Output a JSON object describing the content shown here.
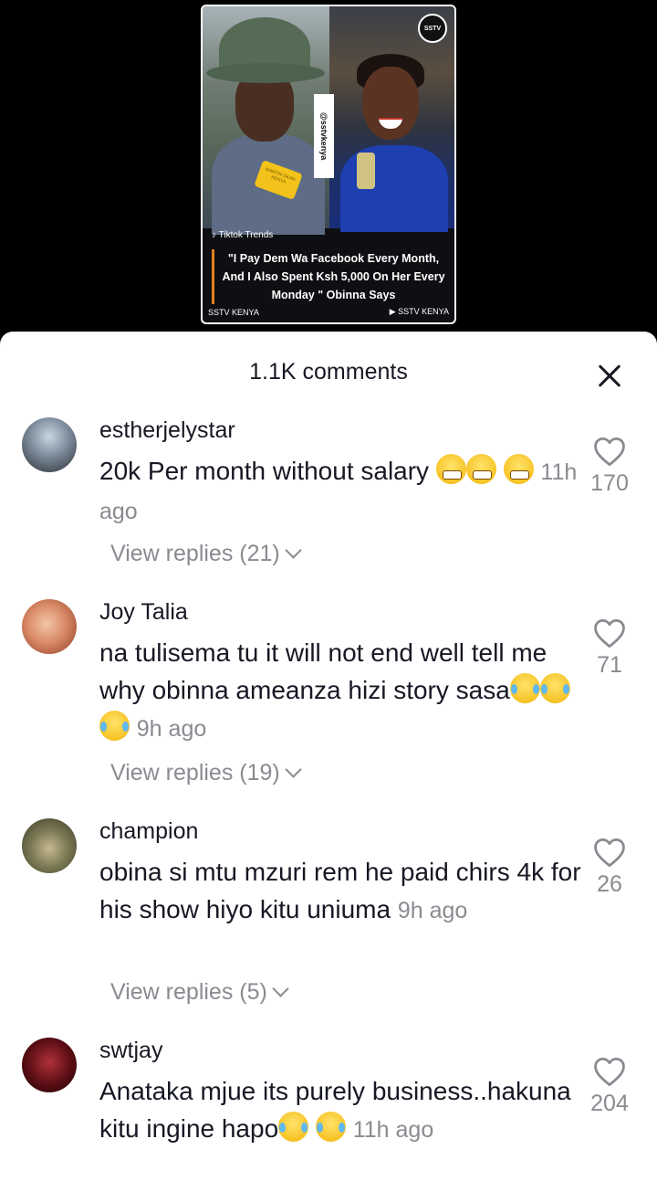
{
  "video": {
    "tag": "Tiktok Trends",
    "handle": "@sstvkenya",
    "logo": "SSTV",
    "mic_text": "MARTIN OKAN KENYA",
    "headline": "\"I Pay Dem Wa Facebook Every Month, And I Also Spent Ksh 5,000 On Her Every Monday \" Obinna Says",
    "footer_left": "SSTV KENYA",
    "footer_right": "SSTV KENYA"
  },
  "sheet": {
    "title": "1.1K comments"
  },
  "comments": [
    {
      "username": "estherjelystar",
      "text": "20k Per month without salary",
      "emoji": "grin",
      "time": "11h ago",
      "likes": "170",
      "replies": "View replies (21)"
    },
    {
      "username": "Joy Talia",
      "text": "na tulisema tu it will not end well tell me why obinna ameanza hizi story sasa",
      "emoji": "cry",
      "time": "9h ago",
      "likes": "71",
      "replies": "View replies (19)"
    },
    {
      "username": "champion",
      "text": "obina si mtu mzuri rem he paid chirs 4k for his show hiyo kitu uniuma",
      "time": "9h ago",
      "likes": "26",
      "replies": "View replies (5)"
    },
    {
      "username": "swtjay",
      "text": "Anataka mjue its purely business..hakuna kitu ingine hapo",
      "emoji": "cry",
      "time": "11h ago",
      "likes": "204"
    }
  ],
  "colors": {
    "text": "#161823",
    "secondary": "#8a8b91",
    "sheet_bg": "#ffffff",
    "backdrop": "#000000"
  }
}
